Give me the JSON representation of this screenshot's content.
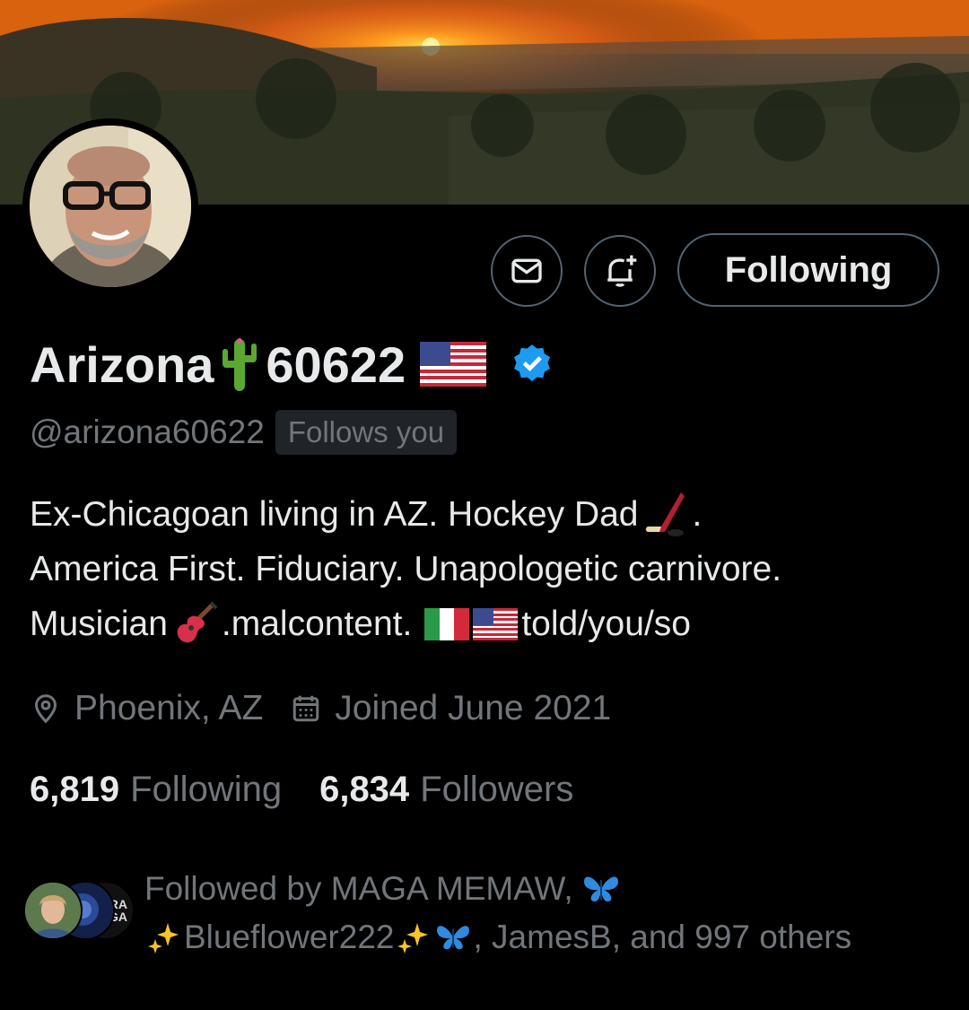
{
  "profile": {
    "display_name_part1": "Arizona",
    "display_name_part2": "60622",
    "handle": "@arizona60622",
    "follows_you_badge": "Follows you",
    "bio_line1": "Ex-Chicagoan living in AZ. Hockey Dad",
    "bio_line1_end": ".",
    "bio_line2": "America First. Fiduciary. Unapologetic carnivore.",
    "bio_line3_start": "Musician",
    "bio_line3_mid": ".malcontent.",
    "bio_line3_end": "told/you/so",
    "location": "Phoenix, AZ",
    "joined": "Joined June 2021"
  },
  "stats": {
    "following_count": "6,819",
    "following_label": "Following",
    "followers_count": "6,834",
    "followers_label": "Followers"
  },
  "actions": {
    "following_button": "Following"
  },
  "followed_by": {
    "line1": "Followed by MAGA MEMAW,",
    "line2_name": "Blueflower222",
    "line2_rest": ", JamesB, and 997 others",
    "avatar_text": "RA GA"
  },
  "icons": {
    "message": "envelope-icon",
    "notify": "bell-plus-icon",
    "location": "map-pin-icon",
    "calendar": "calendar-icon",
    "verified": "verified-badge-icon"
  },
  "colors": {
    "background": "#000000",
    "text_primary": "#e7e9ea",
    "text_secondary": "#71767b",
    "border": "#536471",
    "verified_blue": "#1d9bf0"
  }
}
